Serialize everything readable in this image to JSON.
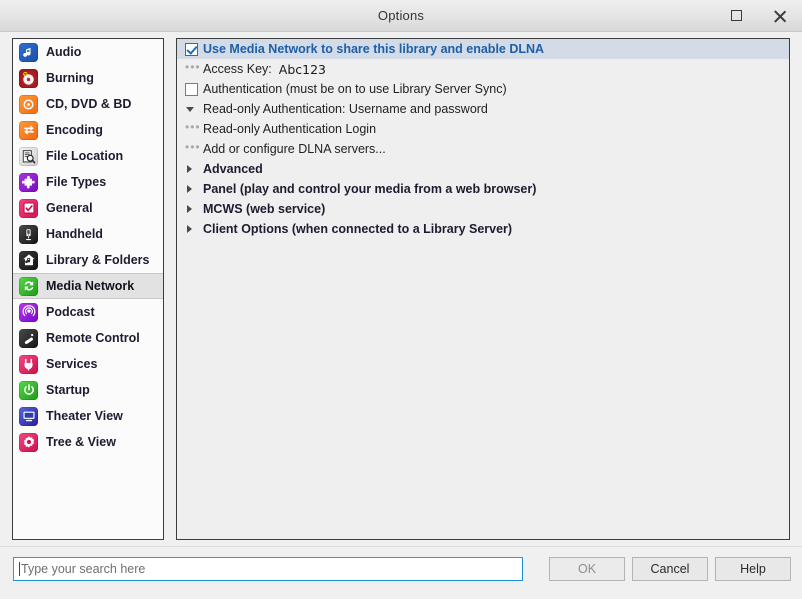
{
  "window": {
    "title": "Options",
    "controls": [
      {
        "name": "maximize-button",
        "icon": "square-icon"
      },
      {
        "name": "close-button",
        "icon": "close-icon"
      }
    ]
  },
  "sidebar": {
    "items": [
      {
        "label": "Audio",
        "icon": "audio-note-icon",
        "selected": false
      },
      {
        "label": "Burning",
        "icon": "burning-disc-icon",
        "selected": false
      },
      {
        "label": "CD, DVD & BD",
        "icon": "optical-disc-icon",
        "selected": false
      },
      {
        "label": "Encoding",
        "icon": "encoding-arrows-icon",
        "selected": false
      },
      {
        "label": "File Location",
        "icon": "file-search-icon",
        "selected": false
      },
      {
        "label": "File Types",
        "icon": "puzzle-piece-icon",
        "selected": false
      },
      {
        "label": "General",
        "icon": "general-check-icon",
        "selected": false
      },
      {
        "label": "Handheld",
        "icon": "handheld-device-icon",
        "selected": false
      },
      {
        "label": "Library & Folders",
        "icon": "library-house-icon",
        "selected": false
      },
      {
        "label": "Media Network",
        "icon": "media-network-icon",
        "selected": true
      },
      {
        "label": "Podcast",
        "icon": "podcast-icon",
        "selected": false
      },
      {
        "label": "Remote Control",
        "icon": "remote-control-icon",
        "selected": false
      },
      {
        "label": "Services",
        "icon": "services-plug-icon",
        "selected": false
      },
      {
        "label": "Startup",
        "icon": "power-icon",
        "selected": false
      },
      {
        "label": "Theater View",
        "icon": "monitor-icon",
        "selected": false
      },
      {
        "label": "Tree & View",
        "icon": "gear-icon",
        "selected": false
      }
    ]
  },
  "content": {
    "rows": [
      {
        "label": "Use Media Network to share this library and enable DLNA",
        "marker": "checkbox-checked",
        "highlight": true
      },
      {
        "label": "Access Key:",
        "marker": "ellipsis",
        "value": "Abc123"
      },
      {
        "label": "Authentication (must be on to use Library Server Sync)",
        "marker": "checkbox-unchecked"
      },
      {
        "label": "Read-only Authentication: Username and password",
        "marker": "triangle-down"
      },
      {
        "label": "Read-only Authentication Login",
        "marker": "ellipsis"
      },
      {
        "label": "Add or configure DLNA servers...",
        "marker": "ellipsis"
      },
      {
        "label": "Advanced",
        "marker": "triangle-right",
        "section": true
      },
      {
        "label": "Panel (play and control your media from a web browser)",
        "marker": "triangle-right",
        "section": true
      },
      {
        "label": "MCWS (web service)",
        "marker": "triangle-right",
        "section": true
      },
      {
        "label": "Client Options (when connected to a Library Server)",
        "marker": "triangle-right",
        "section": true
      }
    ]
  },
  "footer": {
    "search_placeholder": "Type your search here",
    "search_value": "",
    "buttons": [
      {
        "label": "OK",
        "name": "ok-button",
        "disabled": true
      },
      {
        "label": "Cancel",
        "name": "cancel-button",
        "disabled": false
      },
      {
        "label": "Help",
        "name": "help-button",
        "disabled": false
      }
    ]
  },
  "colors": {
    "dialog_bg": "#f0f0f0",
    "highlight_row": "#d2dbe6",
    "highlight_text": "#1d5fa8",
    "panel_border": "#3d3d3d",
    "focus_border": "#1e90d8"
  }
}
